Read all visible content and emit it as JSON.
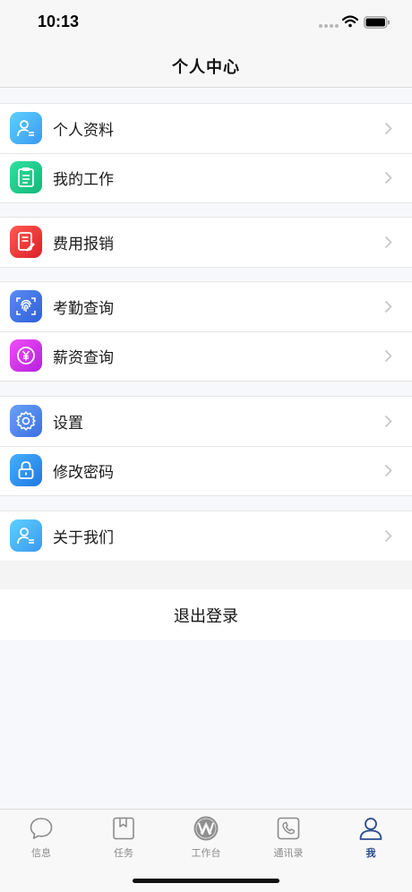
{
  "status_bar": {
    "time": "10:13"
  },
  "nav": {
    "title": "个人中心"
  },
  "menu": {
    "profile": {
      "label": "个人资料",
      "icon": "user-card-icon",
      "color": "#4fb3f5"
    },
    "my_work": {
      "label": "我的工作",
      "icon": "clipboard-icon",
      "color": "#22c98a"
    },
    "expense": {
      "label": "费用报销",
      "icon": "form-edit-icon",
      "color": "#ef3b3b"
    },
    "attendance": {
      "label": "考勤查询",
      "icon": "fingerprint-icon",
      "color": "#3d78e6"
    },
    "salary": {
      "label": "薪资查询",
      "icon": "yen-coin-icon",
      "color": "#d43cf0"
    },
    "settings": {
      "label": "设置",
      "icon": "gear-icon",
      "color": "#4a86ee"
    },
    "password": {
      "label": "修改密码",
      "icon": "lock-icon",
      "color": "#2f8fee"
    },
    "about": {
      "label": "关于我们",
      "icon": "user-card-icon",
      "color": "#4fb3f5"
    }
  },
  "logout": {
    "label": "退出登录"
  },
  "tabs": [
    {
      "label": "信息",
      "icon": "chat-bubble-icon",
      "active": false
    },
    {
      "label": "任务",
      "icon": "bookmark-book-icon",
      "active": false
    },
    {
      "label": "工作台",
      "icon": "workbench-logo-icon",
      "active": false
    },
    {
      "label": "通讯录",
      "icon": "phone-icon",
      "active": false
    },
    {
      "label": "我",
      "icon": "person-icon",
      "active": true
    }
  ],
  "colors": {
    "active_tab": "#2a4a8e",
    "inactive_tab": "#8a8a8a"
  }
}
